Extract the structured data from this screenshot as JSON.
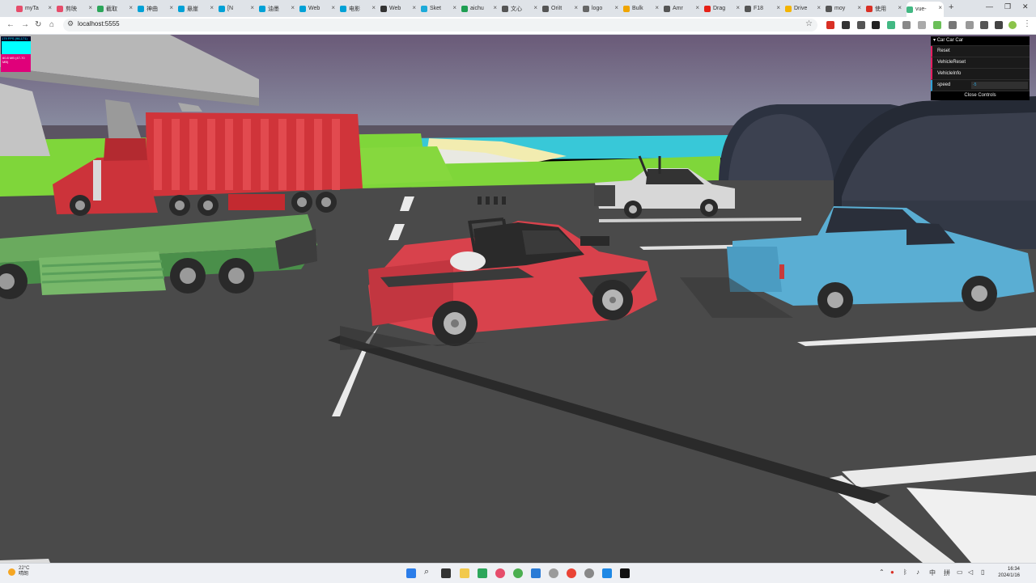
{
  "browser": {
    "tabs": [
      {
        "label": "myTa",
        "icon": "bilibili-icon",
        "color": "#e64d6b"
      },
      {
        "label": "剪映",
        "icon": "bilibili-icon",
        "color": "#e64d6b"
      },
      {
        "label": "截取",
        "icon": "leaf-icon",
        "color": "#2ca65a"
      },
      {
        "label": "神曲",
        "icon": "bilibili-tv-icon",
        "color": "#00a1d6"
      },
      {
        "label": "悬崖",
        "icon": "bilibili-tv-icon",
        "color": "#00a1d6"
      },
      {
        "label": "[N",
        "icon": "bilibili-tv-icon",
        "color": "#00a1d6"
      },
      {
        "label": "油墨",
        "icon": "bilibili-tv-icon",
        "color": "#00a1d6"
      },
      {
        "label": "Web",
        "icon": "bilibili-tv-icon",
        "color": "#00a1d6"
      },
      {
        "label": "电影",
        "icon": "bilibili-tv-icon",
        "color": "#00a1d6"
      },
      {
        "label": "Web",
        "icon": "ws-icon",
        "color": "#333333"
      },
      {
        "label": "Sket",
        "icon": "sketchfab-icon",
        "color": "#1caad9"
      },
      {
        "label": "aichu",
        "icon": "sheet-icon",
        "color": "#1e9e52"
      },
      {
        "label": "文心",
        "icon": "globe-icon",
        "color": "#555555"
      },
      {
        "label": "OriIt",
        "icon": "globe-icon",
        "color": "#555555"
      },
      {
        "label": "logo",
        "icon": "page-icon",
        "color": "#666666"
      },
      {
        "label": "Bulk",
        "icon": "bulk-icon",
        "color": "#f0a500"
      },
      {
        "label": "Amr",
        "icon": "globe-icon",
        "color": "#555555"
      },
      {
        "label": "Drag",
        "icon": "youtube-icon",
        "color": "#e62117"
      },
      {
        "label": "F18",
        "icon": "globe-icon",
        "color": "#555555"
      },
      {
        "label": "Drive",
        "icon": "drive-icon",
        "color": "#f4b400"
      },
      {
        "label": "moy",
        "icon": "globe-icon",
        "color": "#555555"
      },
      {
        "label": "使用",
        "icon": "red-square-icon",
        "color": "#d93025"
      },
      {
        "label": "vue-",
        "icon": "vue-icon",
        "color": "#42b883",
        "active": true
      }
    ],
    "url": "localhost:5555"
  },
  "stats": {
    "fps_text": "179 FPS (96-171)",
    "mem_text": "60.8 MB (47-70 MB)"
  },
  "gui": {
    "title": "Car Car Car",
    "items": [
      {
        "label": "Reset"
      },
      {
        "label": "VehicleReset"
      },
      {
        "label": "VehicleInfo"
      }
    ],
    "speed_label": "speed",
    "speed_value": "-5",
    "close_label": "Close Controls"
  },
  "taskbar": {
    "temperature": "22°C",
    "weather": "晴朗",
    "time": "16:34",
    "date": "2024/1/16",
    "ime_lang": "中",
    "ime_mode": "拼"
  },
  "colors": {
    "sky_top": "#6a5a78",
    "sky_bottom": "#8d93a6",
    "ground": "#4a4a4a",
    "grass": "#7fd63a",
    "water": "#38c8d8",
    "red_car": "#d8424c",
    "blue_car": "#5aaed3",
    "white_car": "#d7d7d7",
    "truck_red": "#d0343a",
    "trailer_green": "#5aa05a",
    "gui_accent": "#e61d5f",
    "gui_number": "#2fa1d6"
  }
}
